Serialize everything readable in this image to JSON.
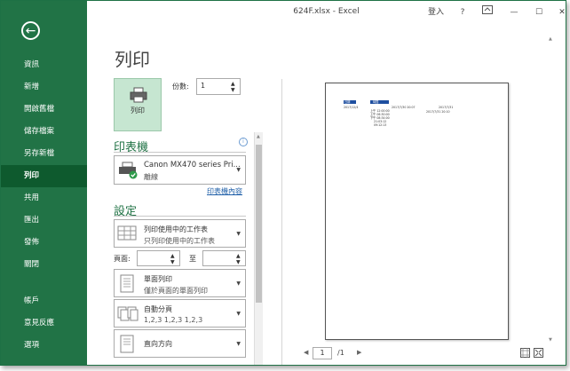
{
  "window": {
    "title": "624F.xlsx - Excel",
    "signin": "登入",
    "help": "?",
    "minimize": "—",
    "restore": "☐",
    "close": "✕"
  },
  "sidebar": {
    "back": "←",
    "items": [
      "資訊",
      "新增",
      "開啟舊檔",
      "儲存檔案",
      "另存新檔",
      "列印",
      "共用",
      "匯出",
      "發佈",
      "關閉",
      "帳戶",
      "意見反應",
      "選項"
    ],
    "active": "列印"
  },
  "print": {
    "heading": "列印",
    "button_label": "列印",
    "copies_label": "份數:",
    "copies_value": "1"
  },
  "printer": {
    "section": "印表機",
    "name": "Canon MX470 series Pri...",
    "status": "離線",
    "properties_link": "印表機內容",
    "info": "i"
  },
  "settings": {
    "section": "設定",
    "scope": {
      "title": "列印使用中的工作表",
      "sub": "只列印使用中的工作表"
    },
    "pages_label": "頁面:",
    "to_label": "至",
    "sides": {
      "title": "單面列印",
      "sub": "僅於頁面的單面列印"
    },
    "collate": {
      "title": "自動分頁",
      "sub": "1,2,3    1,2,3    1,2,3"
    },
    "orientation": {
      "title": "直向方向"
    }
  },
  "preview": {
    "page_number": "1",
    "of_pages": "/1",
    "headers": [
      "日期",
      "時間"
    ],
    "cells": [
      "2017/12/4",
      "2017/7/30 20:07",
      "2017/7/31",
      "上午 12:00:00",
      "2017/7/31 20:10",
      "上午 06:30:00",
      "下午 08:34:00",
      "21:03:12",
      "09:12:13"
    ]
  }
}
